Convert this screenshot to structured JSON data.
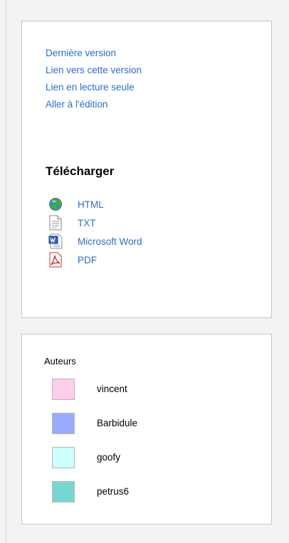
{
  "links": [
    {
      "label": "Dernière version"
    },
    {
      "label": "Lien vers cette version"
    },
    {
      "label": "Lien en lecture seule"
    },
    {
      "label": "Aller à l'édition"
    }
  ],
  "download": {
    "title": "Télécharger",
    "items": [
      {
        "label": "HTML",
        "icon": "globe-icon"
      },
      {
        "label": "TXT",
        "icon": "text-file-icon"
      },
      {
        "label": "Microsoft Word",
        "icon": "word-file-icon"
      },
      {
        "label": "PDF",
        "icon": "pdf-file-icon"
      }
    ]
  },
  "authors": {
    "title": "Auteurs",
    "items": [
      {
        "name": "vincent",
        "color": "#ffccee"
      },
      {
        "name": "Barbidule",
        "color": "#99aaff"
      },
      {
        "name": "goofy",
        "color": "#ccffff"
      },
      {
        "name": "petrus6",
        "color": "#77d8d2"
      }
    ]
  },
  "colors": {
    "link": "#2a6fc8",
    "panel_border": "#c8c8c8",
    "background": "#f3f3f3"
  }
}
